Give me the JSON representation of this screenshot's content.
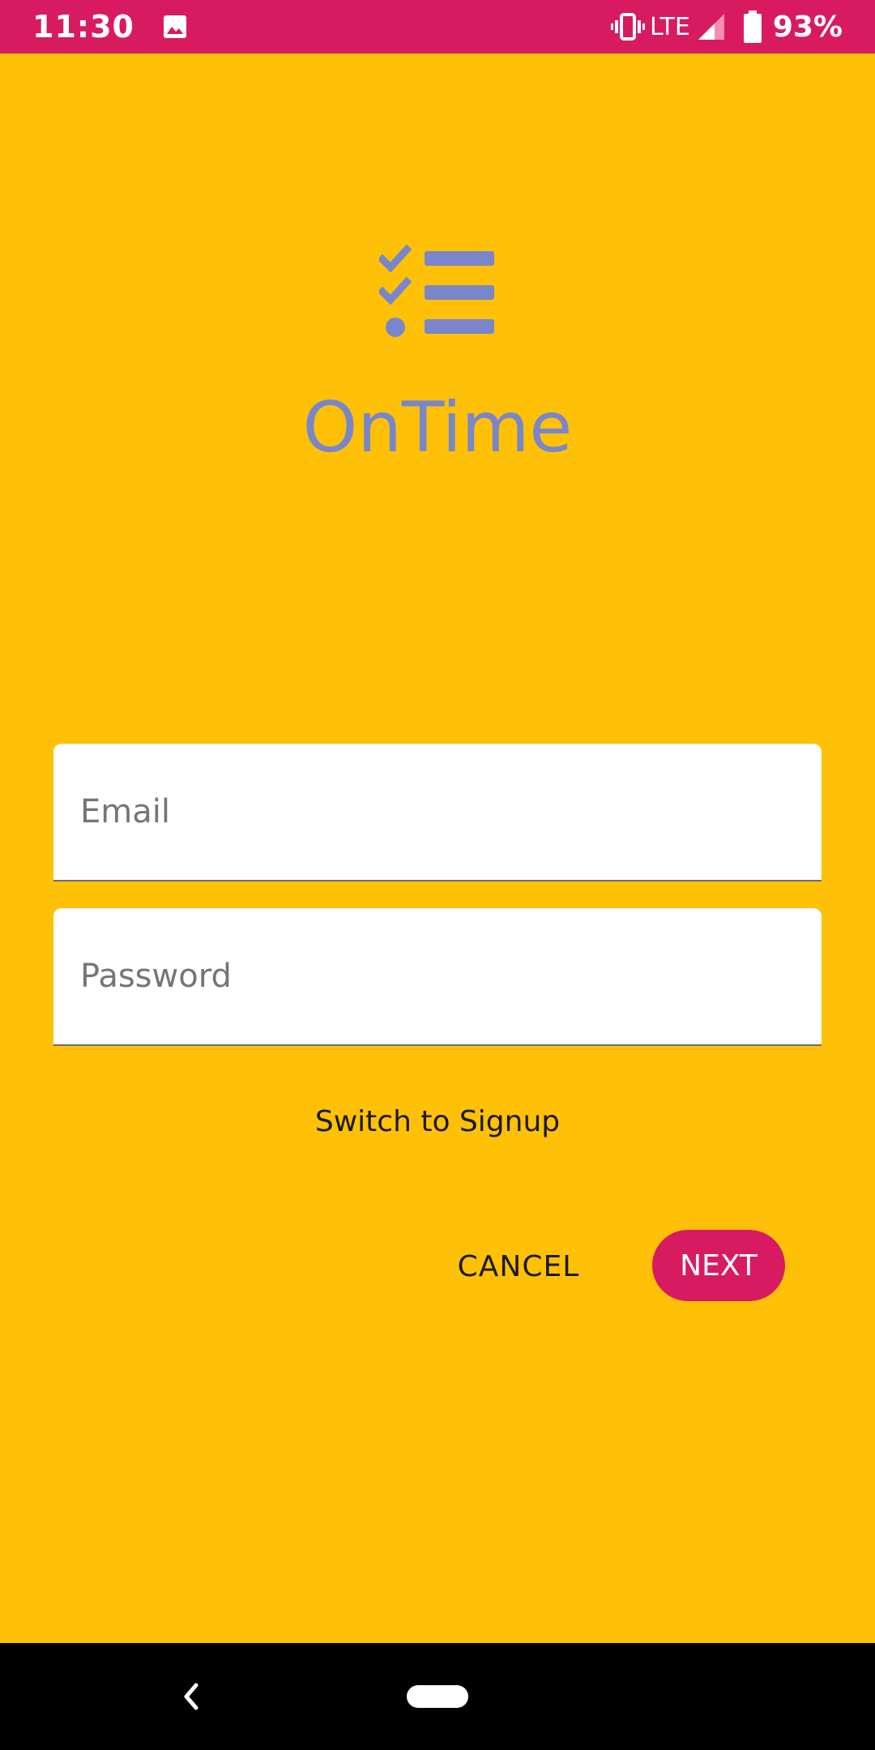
{
  "status_bar": {
    "time": "11:30",
    "network": "LTE",
    "battery": "93%",
    "icons": [
      "photo-icon",
      "vibrate-icon",
      "signal-icon",
      "battery-icon"
    ]
  },
  "app": {
    "title": "OnTime",
    "logo_icon": "checklist-icon"
  },
  "form": {
    "email_placeholder": "Email",
    "email_value": "",
    "password_placeholder": "Password",
    "password_value": "",
    "switch_label": "Switch to Signup",
    "cancel_label": "CANCEL",
    "next_label": "NEXT"
  },
  "nav_bar": {
    "icons": [
      "back-icon",
      "home-pill"
    ]
  },
  "colors": {
    "background": "#FFC107",
    "accent": "#D81B60",
    "logo": "#7986CB"
  }
}
